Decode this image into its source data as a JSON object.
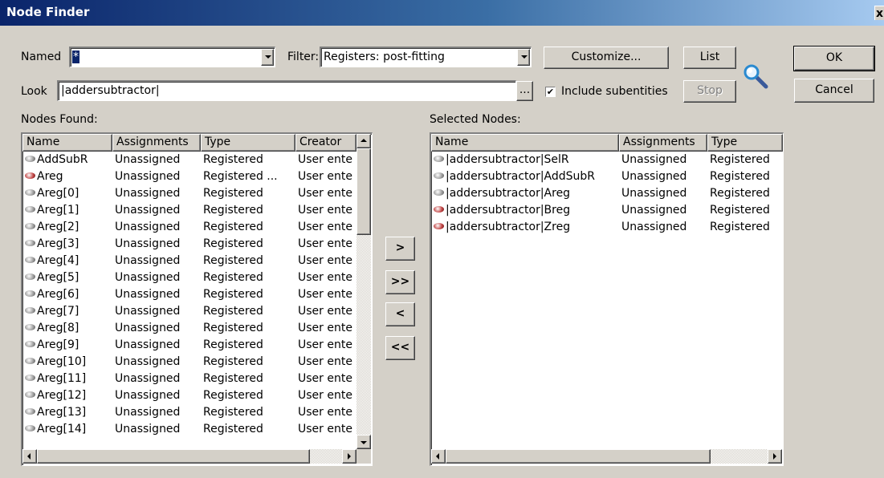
{
  "window": {
    "title": "Node Finder",
    "close_label": "x"
  },
  "named": {
    "label": "Named",
    "value": "*"
  },
  "filter": {
    "label": "Filter:",
    "value": "Registers: post-fitting"
  },
  "look": {
    "label": "Look",
    "value": "|addersubtractor|",
    "browse_label": "..."
  },
  "include_subentities": {
    "label": "Include subentities",
    "checked": true
  },
  "buttons": {
    "customize": "Customize...",
    "list": "List",
    "stop": "Stop",
    "ok": "OK",
    "cancel": "Cancel",
    "add": ">",
    "add_all": ">>",
    "remove": "<",
    "remove_all": "<<"
  },
  "nodes_found": {
    "label": "Nodes Found:",
    "columns": [
      "Name",
      "Assignments",
      "Type",
      "Creator"
    ],
    "rows": [
      [
        "AddSubR",
        "Unassigned",
        "Registered",
        "User ente"
      ],
      [
        "Areg",
        "Unassigned",
        "Registered ...",
        "User ente"
      ],
      [
        "Areg[0]",
        "Unassigned",
        "Registered",
        "User ente"
      ],
      [
        "Areg[1]",
        "Unassigned",
        "Registered",
        "User ente"
      ],
      [
        "Areg[2]",
        "Unassigned",
        "Registered",
        "User ente"
      ],
      [
        "Areg[3]",
        "Unassigned",
        "Registered",
        "User ente"
      ],
      [
        "Areg[4]",
        "Unassigned",
        "Registered",
        "User ente"
      ],
      [
        "Areg[5]",
        "Unassigned",
        "Registered",
        "User ente"
      ],
      [
        "Areg[6]",
        "Unassigned",
        "Registered",
        "User ente"
      ],
      [
        "Areg[7]",
        "Unassigned",
        "Registered",
        "User ente"
      ],
      [
        "Areg[8]",
        "Unassigned",
        "Registered",
        "User ente"
      ],
      [
        "Areg[9]",
        "Unassigned",
        "Registered",
        "User ente"
      ],
      [
        "Areg[10]",
        "Unassigned",
        "Registered",
        "User ente"
      ],
      [
        "Areg[11]",
        "Unassigned",
        "Registered",
        "User ente"
      ],
      [
        "Areg[12]",
        "Unassigned",
        "Registered",
        "User ente"
      ],
      [
        "Areg[13]",
        "Unassigned",
        "Registered",
        "User ente"
      ],
      [
        "Areg[14]",
        "Unassigned",
        "Registered",
        "User ente"
      ]
    ]
  },
  "selected_nodes": {
    "label": "Selected Nodes:",
    "columns": [
      "Name",
      "Assignments",
      "Type"
    ],
    "rows": [
      [
        "|addersubtractor|SelR",
        "Unassigned",
        "Registered"
      ],
      [
        "|addersubtractor|AddSubR",
        "Unassigned",
        "Registered"
      ],
      [
        "|addersubtractor|Areg",
        "Unassigned",
        "Registered"
      ],
      [
        "|addersubtractor|Breg",
        "Unassigned",
        "Registered"
      ],
      [
        "|addersubtractor|Zreg",
        "Unassigned",
        "Registered"
      ]
    ]
  }
}
